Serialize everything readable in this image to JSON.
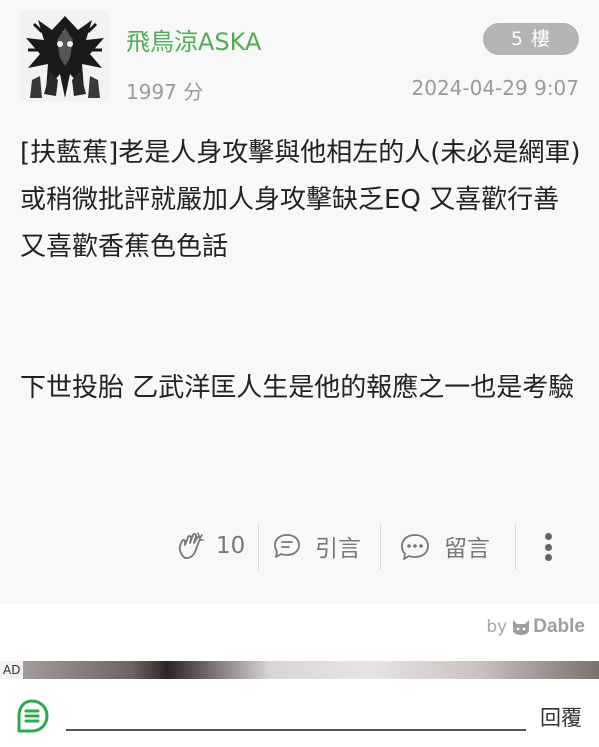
{
  "post": {
    "author_name": "飛鳥涼ASKA",
    "gp_score": "1997 分",
    "floor": "5 樓",
    "timestamp": "2024-04-29 9:07",
    "content": {
      "line1": "[扶藍蕉]老是人身攻擊與他相左的人(未必是網軍)或稍微批評就嚴加人身攻擊缺乏EQ 又喜歡行善 又喜歡香蕉色色話",
      "line2": "下世投胎 乙武洋匡人生是他的報應之一也是考驗"
    }
  },
  "actions": {
    "like_count": "10",
    "quote_label": "引言",
    "comment_label": "留言"
  },
  "ads": {
    "by_label": "by",
    "brand": "Dable",
    "ad_label": "AD"
  },
  "reply": {
    "button_label": "回覆"
  },
  "colors": {
    "author_green": "#4caf50",
    "badge_gray": "#b4b4b4",
    "meta_gray": "#9a9a9a",
    "post_background": "#f8f8f8"
  },
  "icons": {
    "avatar": "mecha-artwork-avatar",
    "like": "clap-hands-icon",
    "quote": "quote-bubbles-icon",
    "comment": "comment-dots-icon",
    "more": "vertical-dots-icon",
    "dable": "dable-cat-logo-icon",
    "reply_menu": "reply-menu-icon"
  }
}
